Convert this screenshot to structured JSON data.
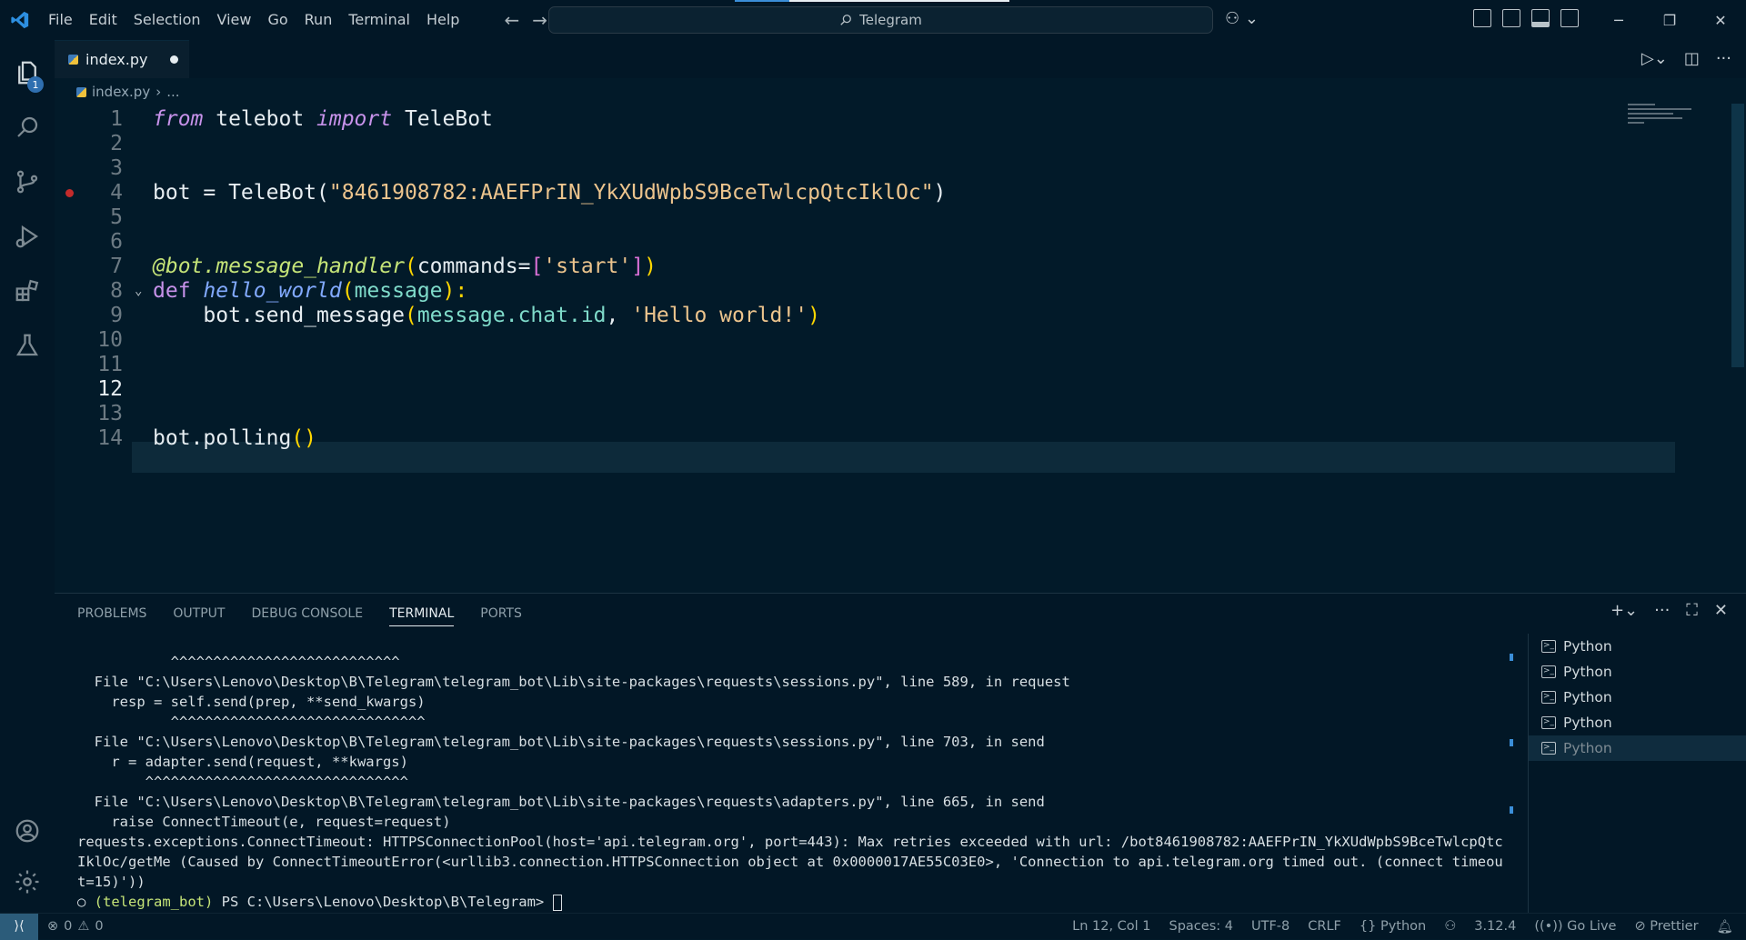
{
  "menu": [
    "File",
    "Edit",
    "Selection",
    "View",
    "Go",
    "Run",
    "Terminal",
    "Help"
  ],
  "command_center": {
    "label": "Telegram"
  },
  "tab": {
    "filename": "index.py"
  },
  "breadcrumb": {
    "file": "index.py",
    "rest": "..."
  },
  "code_lines": [
    {
      "num": "1"
    },
    {
      "num": "2"
    },
    {
      "num": "3"
    },
    {
      "num": "4"
    },
    {
      "num": "5"
    },
    {
      "num": "6"
    },
    {
      "num": "7"
    },
    {
      "num": "8"
    },
    {
      "num": "9"
    },
    {
      "num": "10"
    },
    {
      "num": "11"
    },
    {
      "num": "12"
    },
    {
      "num": "13"
    },
    {
      "num": "14"
    }
  ],
  "code": {
    "l1_from": "from",
    "l1_mod": " telebot ",
    "l1_import": "import",
    "l1_name": " TeleBot",
    "l4_a": "bot = TeleBot(",
    "l4_str": "\"8461908782:AAEFPrIN_YkXUdWpbS9BceTwlcpQtcIklOc\"",
    "l4_b": ")",
    "l7_dec": "@bot.message_handler",
    "l7_p": "(",
    "l7_arg": "commands=",
    "l7_lb": "[",
    "l7_str": "'start'",
    "l7_rb": "]",
    "l7_rp": ")",
    "l8_def": "def",
    "l8_fn": " hello_world",
    "l8_p1": "(",
    "l8_arg": "message",
    "l8_p2": "):",
    "l9_a": "    bot.send_message",
    "l9_p1": "(",
    "l9_arg": "message.chat.id",
    "l9_comma": ", ",
    "l9_str": "'Hello world!'",
    "l9_p2": ")",
    "l14_a": "bot.polling",
    "l14_p": "()"
  },
  "panel_tabs": [
    "PROBLEMS",
    "OUTPUT",
    "DEBUG CONSOLE",
    "TERMINAL",
    "PORTS"
  ],
  "terminal_lines": [
    "           ^^^^^^^^^^^^^^^^^^^^^^^^^^^",
    "  File \"C:\\Users\\Lenovo\\Desktop\\B\\Telegram\\telegram_bot\\Lib\\site-packages\\requests\\sessions.py\", line 589, in request",
    "    resp = self.send(prep, **send_kwargs)",
    "           ^^^^^^^^^^^^^^^^^^^^^^^^^^^^^^",
    "  File \"C:\\Users\\Lenovo\\Desktop\\B\\Telegram\\telegram_bot\\Lib\\site-packages\\requests\\sessions.py\", line 703, in send",
    "    r = adapter.send(request, **kwargs)",
    "        ^^^^^^^^^^^^^^^^^^^^^^^^^^^^^^^",
    "  File \"C:\\Users\\Lenovo\\Desktop\\B\\Telegram\\telegram_bot\\Lib\\site-packages\\requests\\adapters.py\", line 665, in send",
    "    raise ConnectTimeout(e, request=request)",
    "requests.exceptions.ConnectTimeout: HTTPSConnectionPool(host='api.telegram.org', port=443): Max retries exceeded with url: /bot8461908782:AAEFPrIN_YkXUdWpbS9BceTwlcpQtc",
    "IklOc/getMe (Caused by ConnectTimeoutError(<urllib3.connection.HTTPSConnection object at 0x0000017AE55C03E0>, 'Connection to api.telegram.org timed out. (connect timeou",
    "t=15)'))"
  ],
  "terminal_prompt": {
    "env": "(telegram_bot)",
    "path": " PS C:\\Users\\Lenovo\\Desktop\\B\\Telegram> "
  },
  "terminal_list": [
    "Python",
    "Python",
    "Python",
    "Python",
    "Python"
  ],
  "status": {
    "errors": "0",
    "warnings": "0",
    "position": "Ln 12, Col 1",
    "spaces": "Spaces: 4",
    "encoding": "UTF-8",
    "eol": "CRLF",
    "language": "Python",
    "version": "3.12.4",
    "golive": "Go Live",
    "prettier": "Prettier"
  },
  "accent_colors": {
    "breakpoint": "#c42b2b",
    "status_remote": "#2c5c7a"
  }
}
